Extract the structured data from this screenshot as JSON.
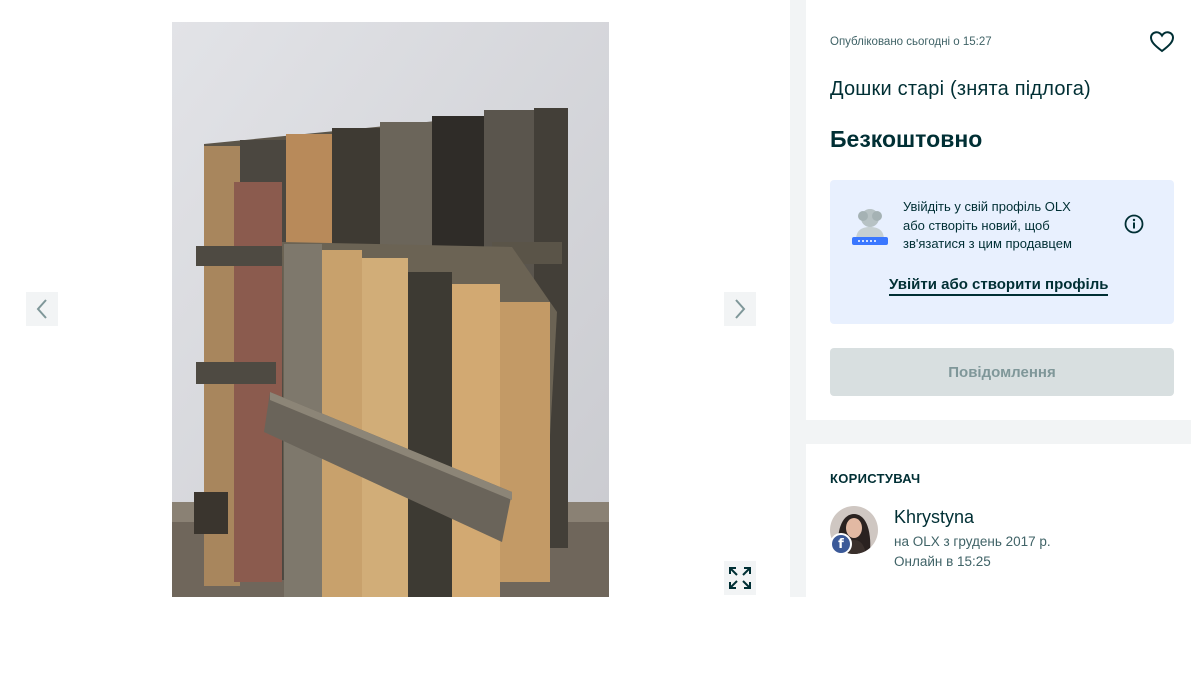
{
  "gallery": {
    "prev_icon": "chevron-left-icon",
    "next_icon": "chevron-right-icon",
    "fullscreen_icon": "expand-icon"
  },
  "ad": {
    "posted": "Опубліковано сьогодні о 15:27",
    "favorite_icon": "heart-icon",
    "title": "Дошки старі (знята підлога)",
    "price": "Безкоштовно"
  },
  "login_prompt": {
    "line1": "Увійдіть у свій профіль OLX",
    "line2": "або створіть новий, щоб",
    "line3": "зв'язатися з цим продавцем",
    "link": "Увійти або створити профіль",
    "info_icon": "info-icon"
  },
  "message_button": "Повідомлення",
  "user": {
    "heading": "КОРИСТУВАЧ",
    "name": "Khrystyna",
    "since": "на OLX з грудень 2017 р.",
    "online": "Онлайн в 15:25",
    "badge": "f"
  },
  "colors": {
    "primary": "#002f34",
    "secondary_text": "#406367",
    "login_bg": "#e8f0fe",
    "disabled_button": "#d8dfe0",
    "facebook": "#3b5998"
  }
}
